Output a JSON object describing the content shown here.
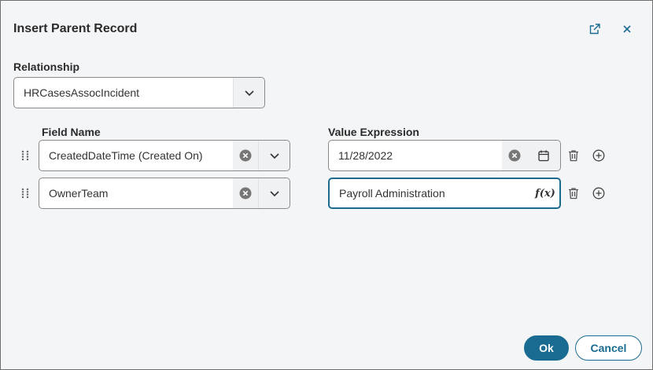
{
  "dialog": {
    "title": "Insert Parent Record",
    "popout_icon": "external-link-icon",
    "close_icon": "close-icon"
  },
  "relationship": {
    "label": "Relationship",
    "value": "HRCasesAssocIncident"
  },
  "columns": {
    "field_name": "Field Name",
    "value_expression": "Value Expression"
  },
  "rows": [
    {
      "field": "CreatedDateTime (Created On)",
      "value": "11/28/2022",
      "value_icon": "calendar-icon"
    },
    {
      "field": "OwnerTeam",
      "value": "Payroll Administration",
      "value_icon": "function-icon",
      "value_icon_text": "f(x)"
    }
  ],
  "buttons": {
    "ok": "Ok",
    "cancel": "Cancel"
  },
  "colors": {
    "primary": "#1a6b91",
    "background": "#f4f5f7",
    "focus_border": "#1c6b8e"
  }
}
